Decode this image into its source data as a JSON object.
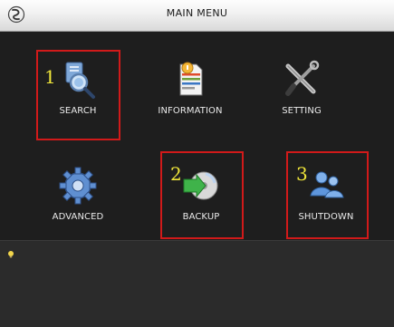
{
  "window": {
    "title": "MAIN MENU",
    "logo_icon": "dahua-logo-icon"
  },
  "menu": {
    "items": [
      {
        "label": "SEARCH",
        "icon": "search-magnifier-icon"
      },
      {
        "label": "INFORMATION",
        "icon": "information-document-icon"
      },
      {
        "label": "SETTING",
        "icon": "wrench-screwdriver-icon"
      },
      {
        "label": "ADVANCED",
        "icon": "gear-icon"
      },
      {
        "label": "BACKUP",
        "icon": "backup-disk-icon"
      },
      {
        "label": "SHUTDOWN",
        "icon": "shutdown-user-icon"
      }
    ]
  },
  "annotations": {
    "markers": [
      {
        "number": "1",
        "target": "SEARCH"
      },
      {
        "number": "2",
        "target": "BACKUP"
      },
      {
        "number": "3",
        "target": "SHUTDOWN"
      }
    ],
    "marker_color": "#d11a1a",
    "number_color": "#f0e63a"
  },
  "status": {
    "tip_icon": "lightbulb-icon"
  }
}
